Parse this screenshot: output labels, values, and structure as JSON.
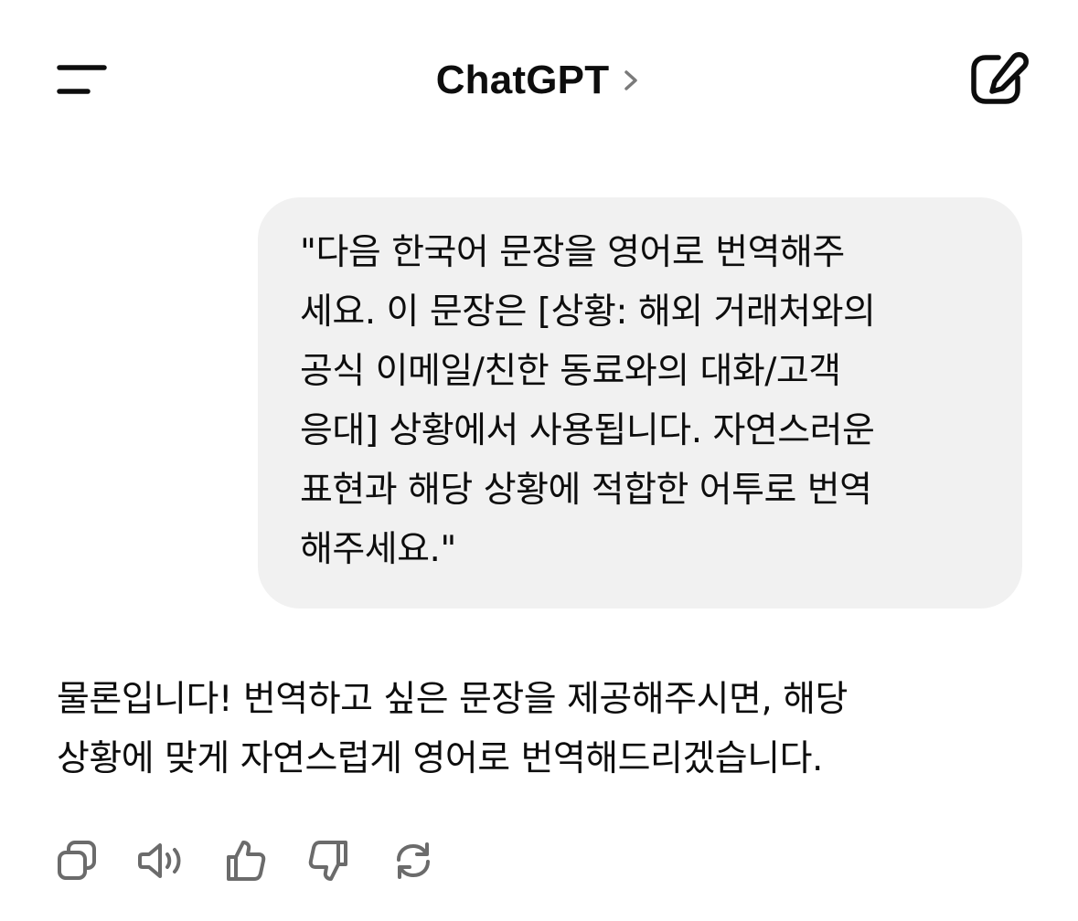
{
  "header": {
    "title": "ChatGPT",
    "menu_icon": "menu-icon",
    "chevron_icon": "chevron-right-icon",
    "new_chat_icon": "new-chat-icon"
  },
  "messages": {
    "user": {
      "text": "\"다음 한국어 문장을 영어로 번역해주\n세요. 이 문장은 [상황: 해외 거래처와의\n공식 이메일/친한 동료와의 대화/고객\n응대] 상황에서 사용됩니다. 자연스러운\n표현과 해당 상황에 적합한 어투로 번역\n해주세요.\""
    },
    "assistant": {
      "text": "물론입니다! 번역하고 싶은 문장을 제공해주시면, 해당\n상황에 맞게 자연스럽게 영어로 번역해드리겠습니다."
    }
  },
  "actions": [
    {
      "icon": "copy-icon"
    },
    {
      "icon": "read-aloud-icon"
    },
    {
      "icon": "thumbs-up-icon"
    },
    {
      "icon": "thumbs-down-icon"
    },
    {
      "icon": "regenerate-icon"
    }
  ],
  "colors": {
    "background": "#ffffff",
    "bubble": "#f1f1f1",
    "text": "#0d0d0d",
    "icon_muted": "#6b6b6b"
  }
}
